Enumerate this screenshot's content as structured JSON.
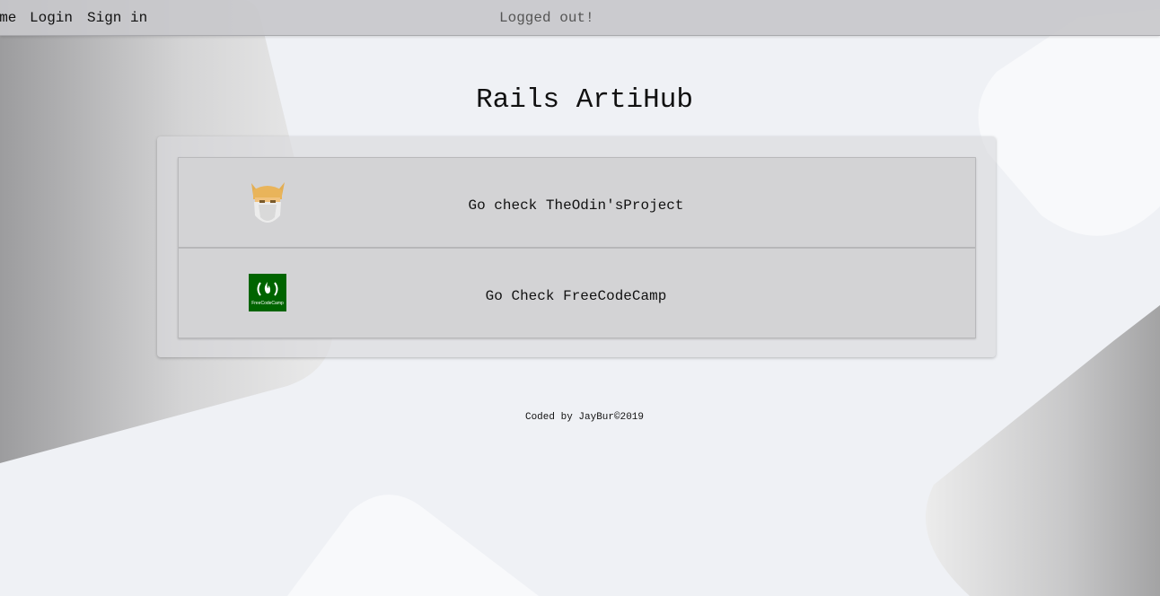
{
  "nav": {
    "home_label": "Home",
    "login_label": "Login",
    "signin_label": "Sign in"
  },
  "flash": {
    "message": "Logged out!"
  },
  "main": {
    "title": "Rails ArtiHub",
    "links": [
      {
        "label": "Go check TheOdin'sProject",
        "icon": "odin-logo-icon"
      },
      {
        "label": "Go Check FreeCodeCamp",
        "icon": "freecodecamp-logo-icon",
        "logo_text": "FreeCodeCamp"
      }
    ]
  },
  "footer": {
    "text": "Coded by JayBur©2019"
  },
  "colors": {
    "background": "#eff1f5",
    "navbar": "#c8c8cb",
    "card": "#d3d3d5",
    "fcc_green": "#006400",
    "odin_helmet": "#e3ae53"
  }
}
